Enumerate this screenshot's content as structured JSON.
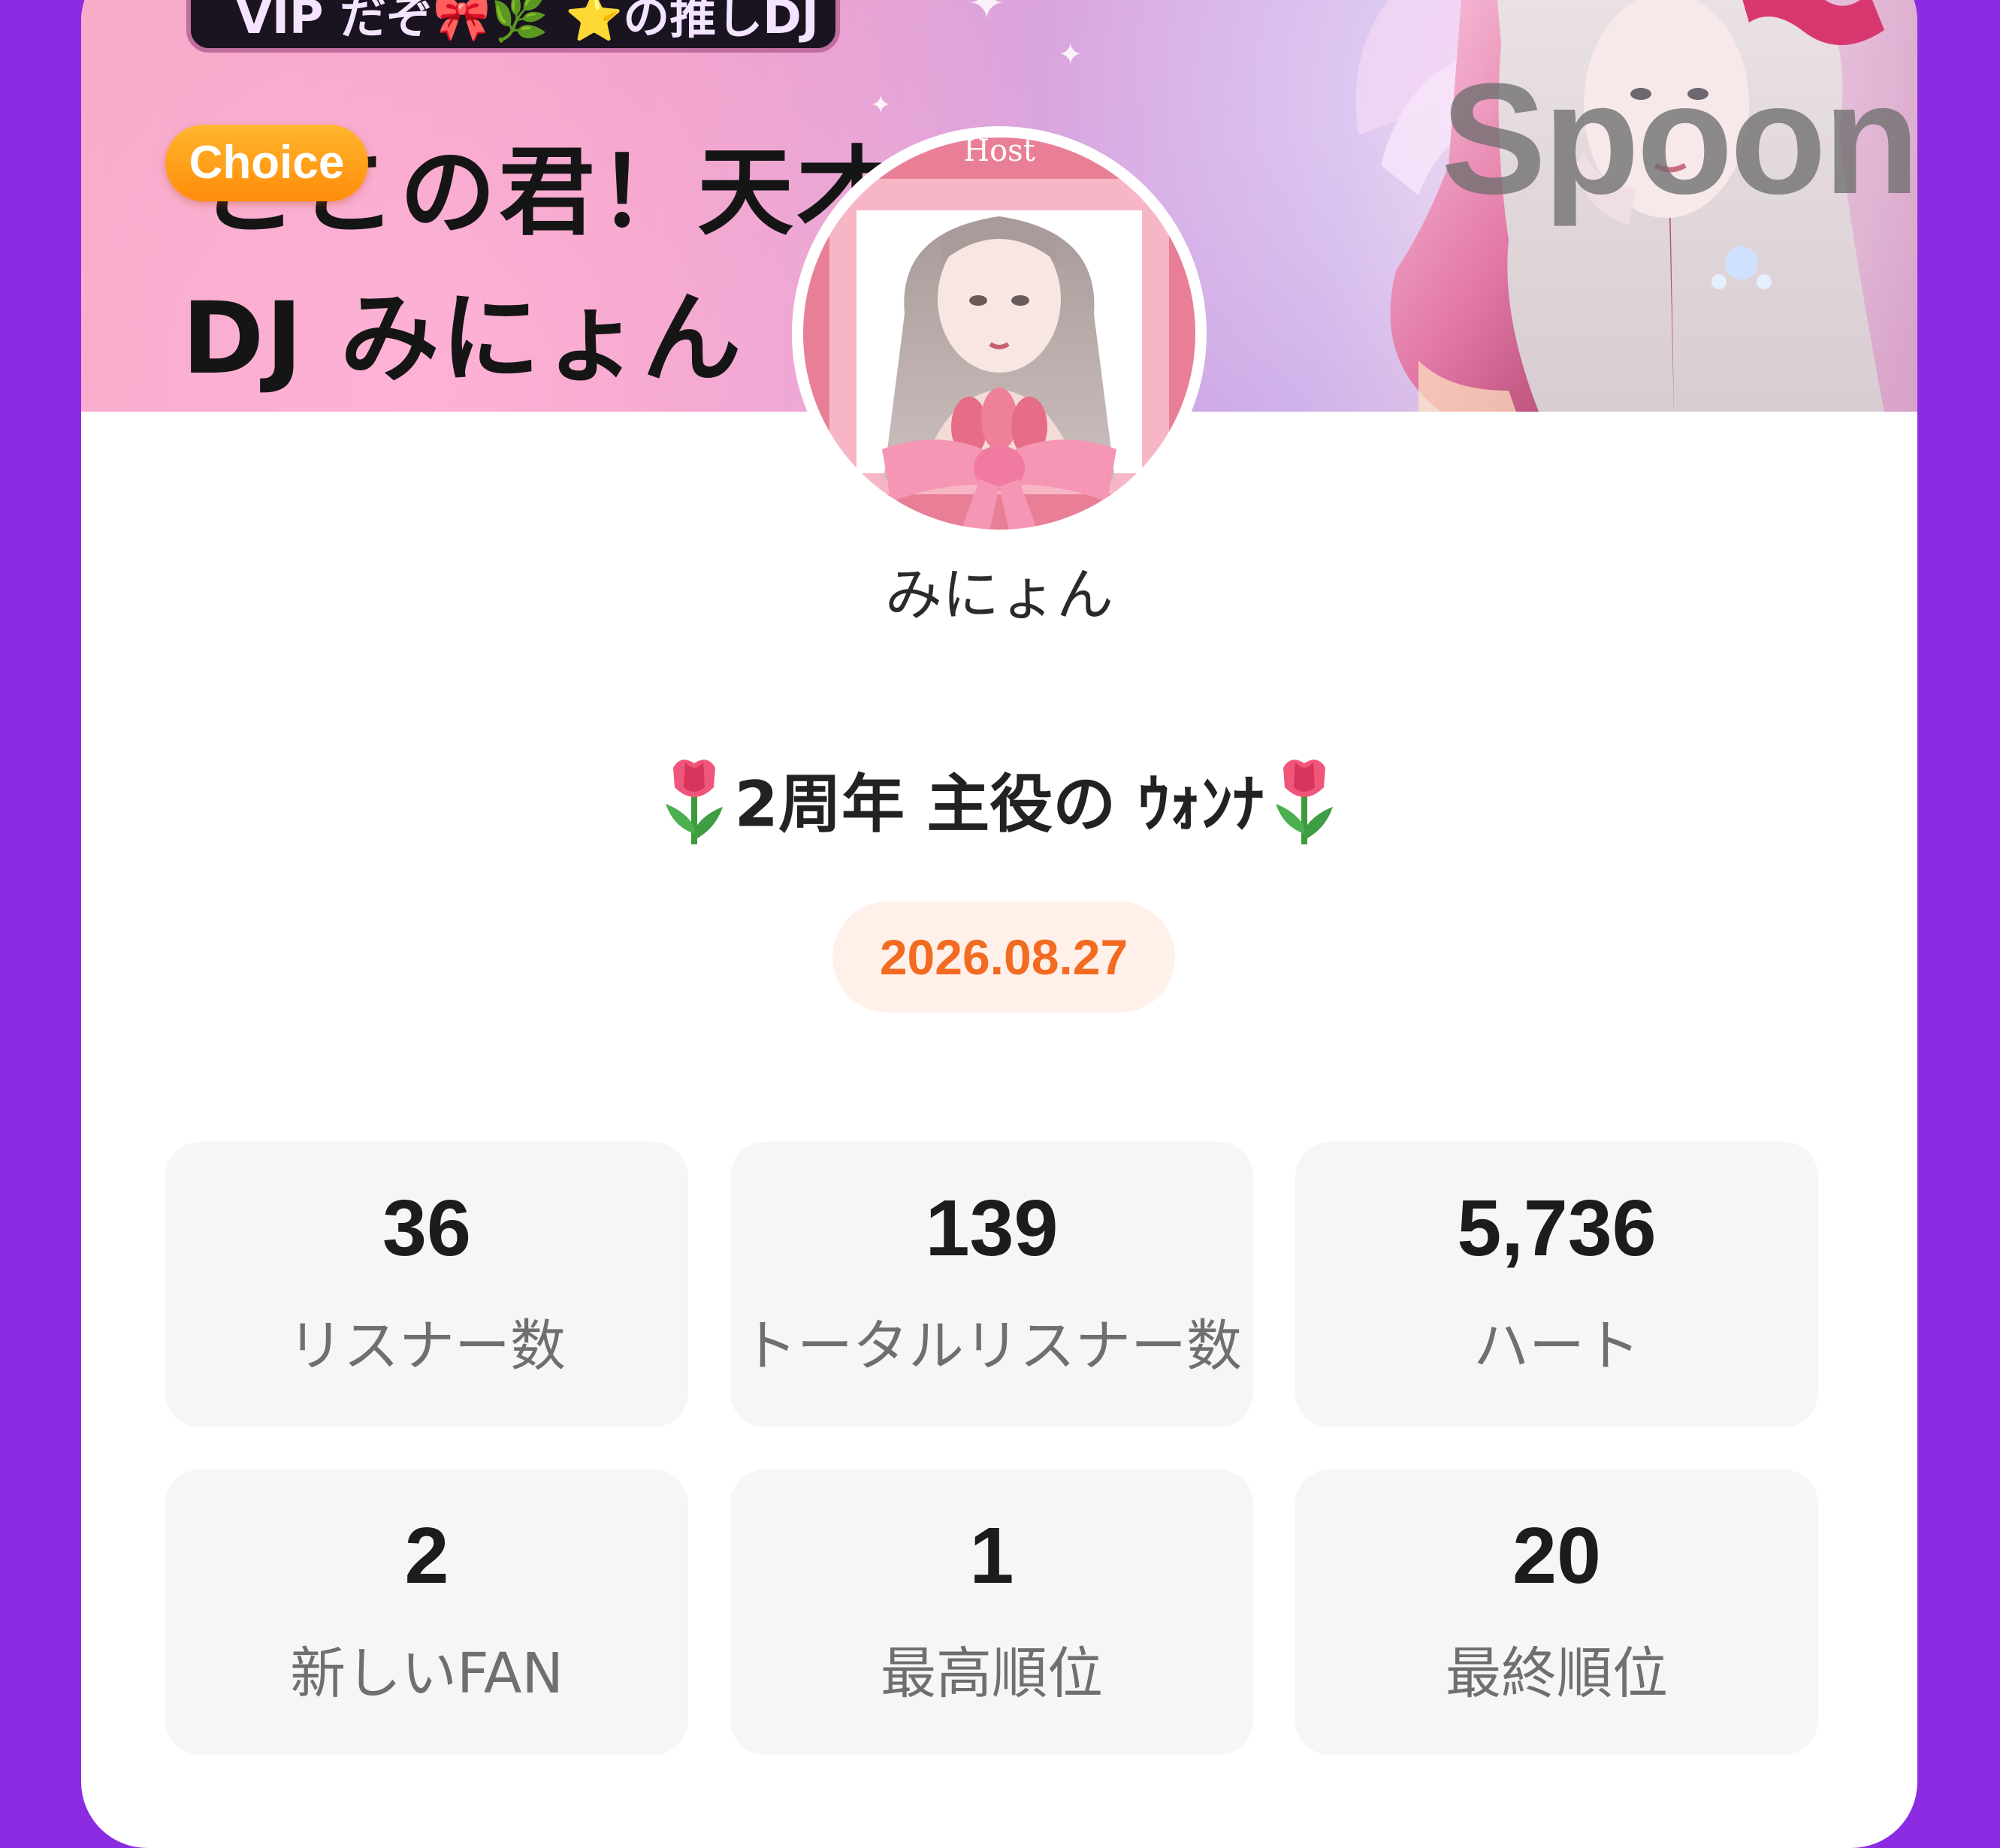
{
  "banner": {
    "strip_text": "VIP だぞ🎀🌿  ⭐の推しDJ",
    "headline_line1": "ここの君！天才",
    "headline_line2": "DJ みにょん",
    "choice_badge": "Choice",
    "brand": "Spoon",
    "avatar_caption": "Host"
  },
  "profile": {
    "username": "みにょん",
    "live_title": "2周年 主役の ｳｫﾝﾅ",
    "date": "2026.08.27"
  },
  "stats": [
    {
      "value": "36",
      "label": "リスナー数"
    },
    {
      "value": "139",
      "label": "トータルリスナー数"
    },
    {
      "value": "5,736",
      "label": "ハート"
    },
    {
      "value": "2",
      "label": "新しいFAN"
    },
    {
      "value": "1",
      "label": "最高順位"
    },
    {
      "value": "20",
      "label": "最終順位"
    }
  ],
  "colors": {
    "background": "#8b2be2",
    "card": "#ffffff",
    "date_text": "#f26b21",
    "date_pill": "#fff0ea",
    "stat_tile": "#f6f6f6",
    "choice_badge": "#ff9d1a"
  },
  "icons": {
    "title_decoration": "tulip-icon"
  }
}
